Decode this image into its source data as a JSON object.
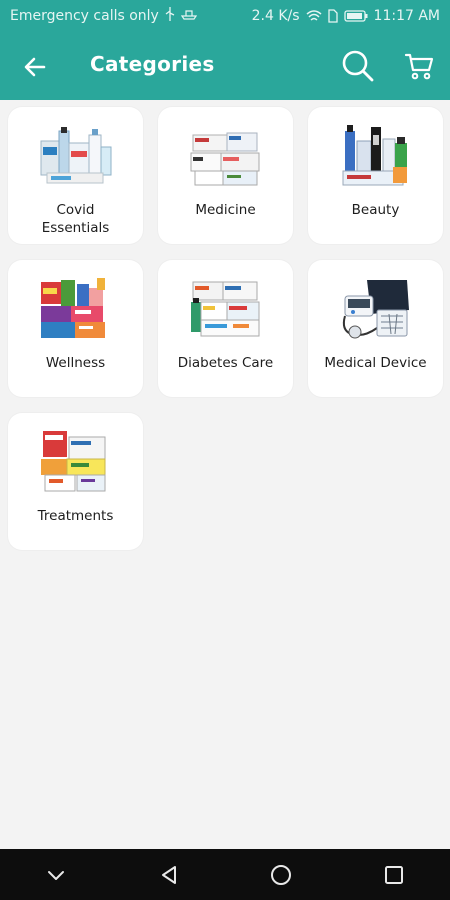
{
  "status_bar": {
    "carrier_text": "Emergency calls only",
    "speed": "2.4 K/s",
    "time": "11:17 AM"
  },
  "app_bar": {
    "title": "Categories",
    "back_icon": "arrow-left-icon",
    "search_icon": "search-icon",
    "cart_icon": "cart-icon",
    "color": "#2aa79b"
  },
  "categories": [
    {
      "label": "Covid\nEssentials",
      "icon": "covid-essentials-products"
    },
    {
      "label": "Medicine",
      "icon": "medicine-boxes"
    },
    {
      "label": "Beauty",
      "icon": "beauty-products"
    },
    {
      "label": "Wellness",
      "icon": "wellness-products"
    },
    {
      "label": "Diabetes Care",
      "icon": "diabetes-care-products"
    },
    {
      "label": "Medical Device",
      "icon": "blood-pressure-monitor"
    },
    {
      "label": "Treatments",
      "icon": "treatment-products"
    }
  ],
  "nav_bar": {
    "icons": [
      "chevron-down-icon",
      "back-triangle-icon",
      "home-circle-icon",
      "recents-square-icon"
    ]
  }
}
